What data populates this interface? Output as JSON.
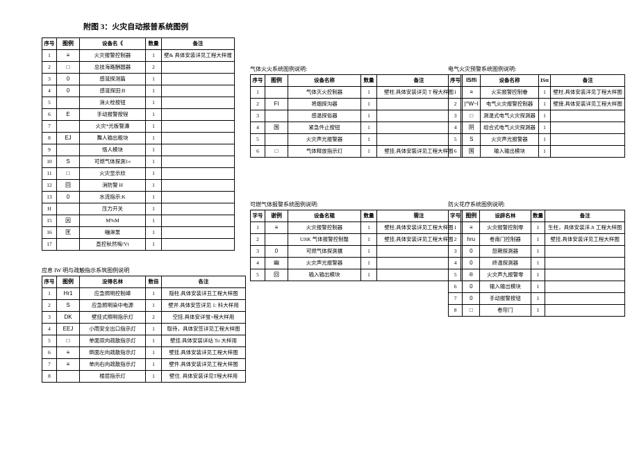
{
  "page_title": "附图 3：火灾自动报普系统图例",
  "headers": {
    "seq": "序号",
    "char": "字号",
    "sym": "图例",
    "legend": "谢例",
    "name": "设备名《",
    "name2": "设备名林",
    "name3": "设备名称",
    "name4": "设备名辊",
    "name5": "设辟名林",
    "name6": "没得名林",
    "qty": "数量",
    "qty2": "数倍",
    "note": "备注",
    "note2": "各注",
    "note3": "需注"
  },
  "tableA": {
    "rows": [
      {
        "seq": "1",
        "sym": "≡",
        "name": "火灾报警控制器",
        "qty": "1",
        "note": "壁& 具体安装详见工程大样煋"
      },
      {
        "seq": "2",
        "sym": "□",
        "name": "总技海路酬圆器",
        "qty": "2",
        "note": ""
      },
      {
        "seq": "3",
        "sym": "0",
        "name": "感涎探测篇",
        "qty": "1",
        "note": ""
      },
      {
        "seq": "4",
        "sym": "0",
        "name": "感涎探田:B",
        "qty": "1",
        "note": ""
      },
      {
        "seq": "5",
        "sym": "",
        "name": "消火栓按钮",
        "qty": "1",
        "note": ""
      },
      {
        "seq": "6",
        "sym": "E",
        "name": "手动报警按锃",
        "qty": "1",
        "note": ""
      },
      {
        "seq": "7",
        "sym": "",
        "name": "火灾*光板警濂",
        "qty": "1",
        "note": ""
      },
      {
        "seq": "8",
        "sym": "EJ",
        "name": "舞人输出粗块",
        "qty": "1",
        "note": ""
      },
      {
        "seq": "9",
        "sym": "",
        "name": "悟人模块",
        "qty": "1",
        "note": ""
      },
      {
        "seq": "10",
        "sym": "S",
        "name": "可燃气体探測1«",
        "qty": "1",
        "note": ""
      },
      {
        "seq": "11",
        "sym": "□",
        "name": "火灾显示欣",
        "qty": "1",
        "note": ""
      },
      {
        "seq": "12",
        "sym": "回",
        "name": "消防警 H",
        "qty": "1",
        "note": ""
      },
      {
        "seq": "13",
        "sym": "0",
        "name": "水流指示:K",
        "qty": "1",
        "note": ""
      },
      {
        "seq": "H",
        "sym": "",
        "name": "压力开关",
        "qty": "1",
        "note": ""
      },
      {
        "seq": "15",
        "sym": "因",
        "name": "M%M",
        "qty": "1",
        "note": ""
      },
      {
        "seq": "16",
        "sym": "匡",
        "name": "嘣淋泵",
        "qty": "1",
        "note": ""
      },
      {
        "seq": "17",
        "sym": "",
        "name": "直控秋然嗚!Vt",
        "qty": "1",
        "note": ""
      }
    ]
  },
  "tableB_title": "应息 IW 明与疏触指示系筑图例说明",
  "tableB": {
    "rows": [
      {
        "seq": "1",
        "sym": "Hr1",
        "name": "应急照明控制嶂",
        "qty": "1",
        "note": "隠柱.具体安装详丑工程大样图"
      },
      {
        "seq": "2",
        "sym": "S",
        "name": "应急照明染中电源",
        "qty": "1",
        "note": "壁并.具体安笠详见 1: 科大样用"
      },
      {
        "seq": "3",
        "sym": "DK",
        "name": "壁挂式照明指示灯",
        "qty": "2",
        "note": "空挂.具体安详蛍+程大样用"
      },
      {
        "seq": "4",
        "sym": "EEJ",
        "name": "小雨安全出口指示灯",
        "qty": "1",
        "note": "取待，具体安笠详见工程大样图"
      },
      {
        "seq": "5",
        "sym": "□",
        "name": "单面双向疏散指示灯",
        "qty": "1",
        "note": "壁挂.具体安装详站 To 大样用"
      },
      {
        "seq": "6",
        "sym": "≡",
        "name": "倒面左向疏散指示灯",
        "qty": "1",
        "note": "壁挂.具体安装详见工程大样图"
      },
      {
        "seq": "7",
        "sym": "≡",
        "name": "单向右向疏散指示灯",
        "qty": "1",
        "note": "壁件.具体安装详见工程大样图"
      },
      {
        "seq": "8",
        "sym": "",
        "name": "楼层指示灯",
        "qty": "1",
        "note": "壁住. 具体安装详见T程大样用"
      }
    ]
  },
  "tableC_title": "气体火火系统图例说明:",
  "tableC": {
    "rows": [
      {
        "seq": "1",
        "sym": "",
        "name": "气体灭火控制器",
        "qty": "1",
        "note": "壁柱.具体安装详见 T 程大样图"
      },
      {
        "seq": "2",
        "sym": "FI",
        "name": "将烟探沟器",
        "qty": "1",
        "note": ""
      },
      {
        "seq": "3",
        "sym": "",
        "name": "感温探俗器",
        "qty": "1",
        "note": ""
      },
      {
        "seq": "4",
        "sym": "国",
        "name": "紧急件止按钮",
        "qty": "1",
        "note": ""
      },
      {
        "seq": "5",
        "sym": "",
        "name": "火灾声光报警器",
        "qty": "1",
        "note": ""
      },
      {
        "seq": "6",
        "sym": "□",
        "name": "气体释放指示灯",
        "qty": "1",
        "note": "壁挂.具体安裝详见工程大样图"
      }
    ]
  },
  "tableD_title": "可燃气体报警系统图例说明:",
  "tableD": {
    "rows": [
      {
        "seq": "1",
        "sym": "≡",
        "name": "火灾报警控制器",
        "qty": "1",
        "note": "壁柱.具体安装详见工程大样图"
      },
      {
        "seq": "2",
        "sym": "",
        "name": "UJtK 气体报警控制罄",
        "qty": "1",
        "note": "壁挂.具体安装详见工程大样图"
      },
      {
        "seq": "3",
        "sym": "0",
        "name": "可燃气体探測搌",
        "qty": "1",
        "note": ""
      },
      {
        "seq": "4",
        "sym": "幽",
        "name": "火灾声光报警器",
        "qty": "1",
        "note": ""
      },
      {
        "seq": "5",
        "sym": "回",
        "name": "输入输出模块",
        "qty": "1",
        "note": ""
      }
    ]
  },
  "tableE_title": "电气火灾预警系统图例说明:",
  "tableE": {
    "rows": [
      {
        "seq": "1",
        "sym": "≡",
        "name": "火实报警控制眷",
        "qty": "1",
        "note": "壁柱.具体安装洋见丁程大样图"
      },
      {
        "seq": "2",
        "sym": "|^W~I",
        "name": "电气火灾报警控制器",
        "qty": "1",
        "note": "壁接.具体安装详见工程大样图"
      },
      {
        "seq": "3",
        "sym": "□",
        "name": "測温式电气火灾探測器",
        "qty": "1",
        "note": ""
      },
      {
        "seq": "4",
        "sym": "阴",
        "name": "组合式电气火灾探測器",
        "qty": "1",
        "note": ""
      },
      {
        "seq": "5",
        "sym": "S",
        "name": "火灾声光报警器",
        "qty": "1",
        "note": ""
      },
      {
        "seq": "6",
        "sym": "国",
        "name": "输入输出模块",
        "qty": "1",
        "note": ""
      }
    ]
  },
  "tableE_extra_header": "IStt",
  "tableE_sym_header": "ISffi",
  "tableF_title": "防火花疗系统图例说明:",
  "tableF": {
    "rows": [
      {
        "seq": "1",
        "sym": "≡",
        "name": "火灾报警控制零",
        "qty": "1",
        "note": "生柱，具体安装洋.Jt 工程大样图"
      },
      {
        "seq": "2",
        "sym": "hru",
        "name": "卷南门控制器",
        "qty": "1",
        "note": "壁挂.具体安装详见工程大样图"
      },
      {
        "seq": "3",
        "sym": "0",
        "name": "怨期探測器",
        "qty": "1",
        "note": ""
      },
      {
        "seq": "4",
        "sym": "0",
        "name": "终温探測器",
        "qty": "1",
        "note": ""
      },
      {
        "seq": "5",
        "sym": "®",
        "name": "火灾声九报警零",
        "qty": "1",
        "note": ""
      },
      {
        "seq": "6",
        "sym": "0",
        "name": "输入输出模块",
        "qty": "1",
        "note": ""
      },
      {
        "seq": "7",
        "sym": "0",
        "name": "手动报警按钮",
        "qty": "1",
        "note": ""
      },
      {
        "seq": "8",
        "sym": "□",
        "name": "卷帘门",
        "qty": "1",
        "note": ""
      }
    ]
  }
}
